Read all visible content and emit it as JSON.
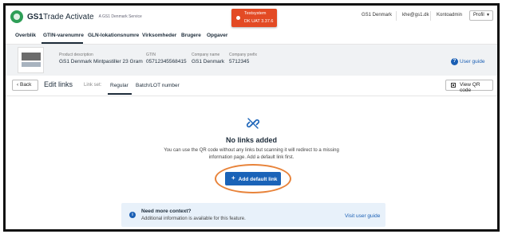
{
  "header": {
    "logo_main": "GS1",
    "logo_suffix": "Trade Activate",
    "logo_sub": "A GS1 Denmark Service",
    "test_badge": {
      "line1": "Testsystem",
      "line2": "DK UAT 3.37.6"
    },
    "org": "GS1 Denmark",
    "email": "khe@gs1.dk",
    "role": "Kontoadmin",
    "profile_label": "Profil"
  },
  "tabs": [
    "Overblik",
    "GTIN-varenumre",
    "GLN-lokationsnumre",
    "Virksomheder",
    "Brugere",
    "Opgaver"
  ],
  "product": {
    "description_label": "Product description",
    "description": "GS1 Denmark Mintpastiller 23 Gram",
    "gtin_label": "GTIN",
    "gtin": "05712345568415",
    "company_label": "Company name",
    "company": "GS1 Denmark",
    "prefix_label": "Company prefix",
    "prefix": "5712345",
    "user_guide": "User guide"
  },
  "editbar": {
    "back": "Back",
    "title": "Edit links",
    "link_set_label": "Link set:",
    "link_tabs": [
      "Regular",
      "Batch/LOT number"
    ],
    "qr_button": "View QR code"
  },
  "empty_state": {
    "title": "No links added",
    "text": "You can use the QR code without any links but scanning it will redirect to a missing information page. Add a default link first.",
    "add_button": "Add default link"
  },
  "banner": {
    "title": "Need more context?",
    "text": "Additional information is available for this feature.",
    "link": "Visit user guide"
  },
  "colors": {
    "primary": "#1a63b8",
    "test_badge": "#e34a24",
    "highlight": "#e8833a",
    "banner_bg": "#e8f1fa"
  }
}
